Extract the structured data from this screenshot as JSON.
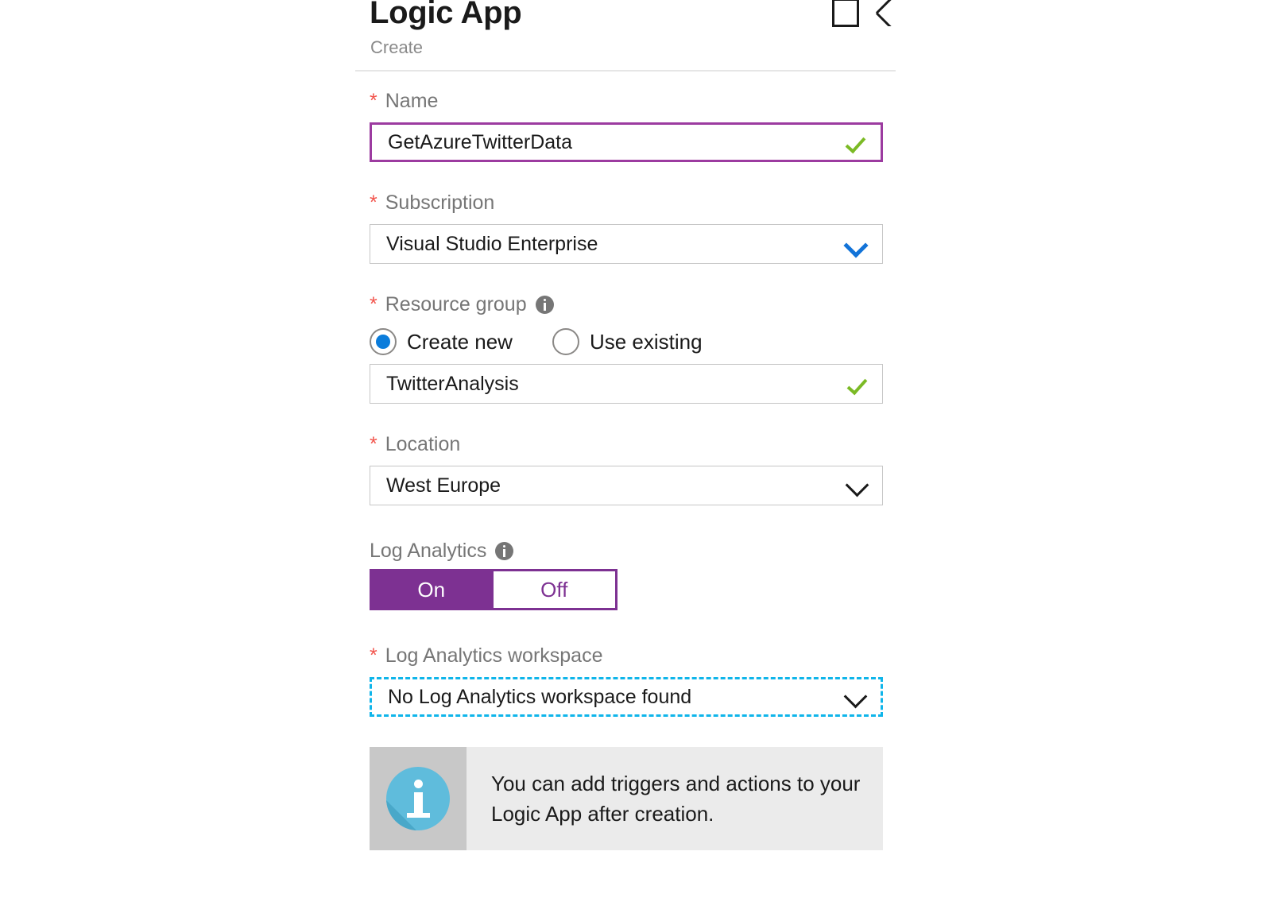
{
  "blade": {
    "title": "Logic App",
    "subtitle": "Create",
    "actions": {
      "maximize": "maximize-blade",
      "close": "close-blade"
    }
  },
  "form": {
    "name": {
      "label": "Name",
      "required_marker": "*",
      "value": "GetAzureTwitterData",
      "validation": "valid",
      "state": "focused",
      "border_color": "#9c3ba0"
    },
    "subscription": {
      "label": "Subscription",
      "required_marker": "*",
      "value": "Visual Studio Enterprise",
      "chevron_color": "#1273d8"
    },
    "resource_group": {
      "label": "Resource group",
      "required_marker": "*",
      "has_info_icon": true,
      "options": [
        {
          "label": "Create new",
          "selected": true
        },
        {
          "label": "Use existing",
          "selected": false
        }
      ],
      "value": "TwitterAnalysis",
      "validation": "valid"
    },
    "location": {
      "label": "Location",
      "required_marker": "*",
      "value": "West Europe",
      "chevron_color": "#1a1a1a"
    },
    "log_analytics": {
      "label": "Log Analytics",
      "has_info_icon": true,
      "on_label": "On",
      "off_label": "Off",
      "selected": "On",
      "accent_color": "#7d3192"
    },
    "log_analytics_workspace": {
      "label": "Log Analytics workspace",
      "required_marker": "*",
      "value": "No Log Analytics workspace found",
      "state": "focused-dashed",
      "border_color": "#0fb5ea"
    }
  },
  "info_banner": {
    "icon": "information-icon",
    "message": "You can add triggers and actions to your Logic App after creation."
  },
  "colors": {
    "required_star": "#f2544c",
    "label_gray": "#767676",
    "valid_check": "#7bba25",
    "radio_blue": "#0a7cdb",
    "purple_accent": "#7d3192",
    "focus_purple": "#9c3ba0",
    "focus_cyan": "#0fb5ea",
    "banner_bg": "#ebebeb",
    "banner_icon_bg": "#c8c8c8",
    "info_circle": "#5fbcdc"
  }
}
